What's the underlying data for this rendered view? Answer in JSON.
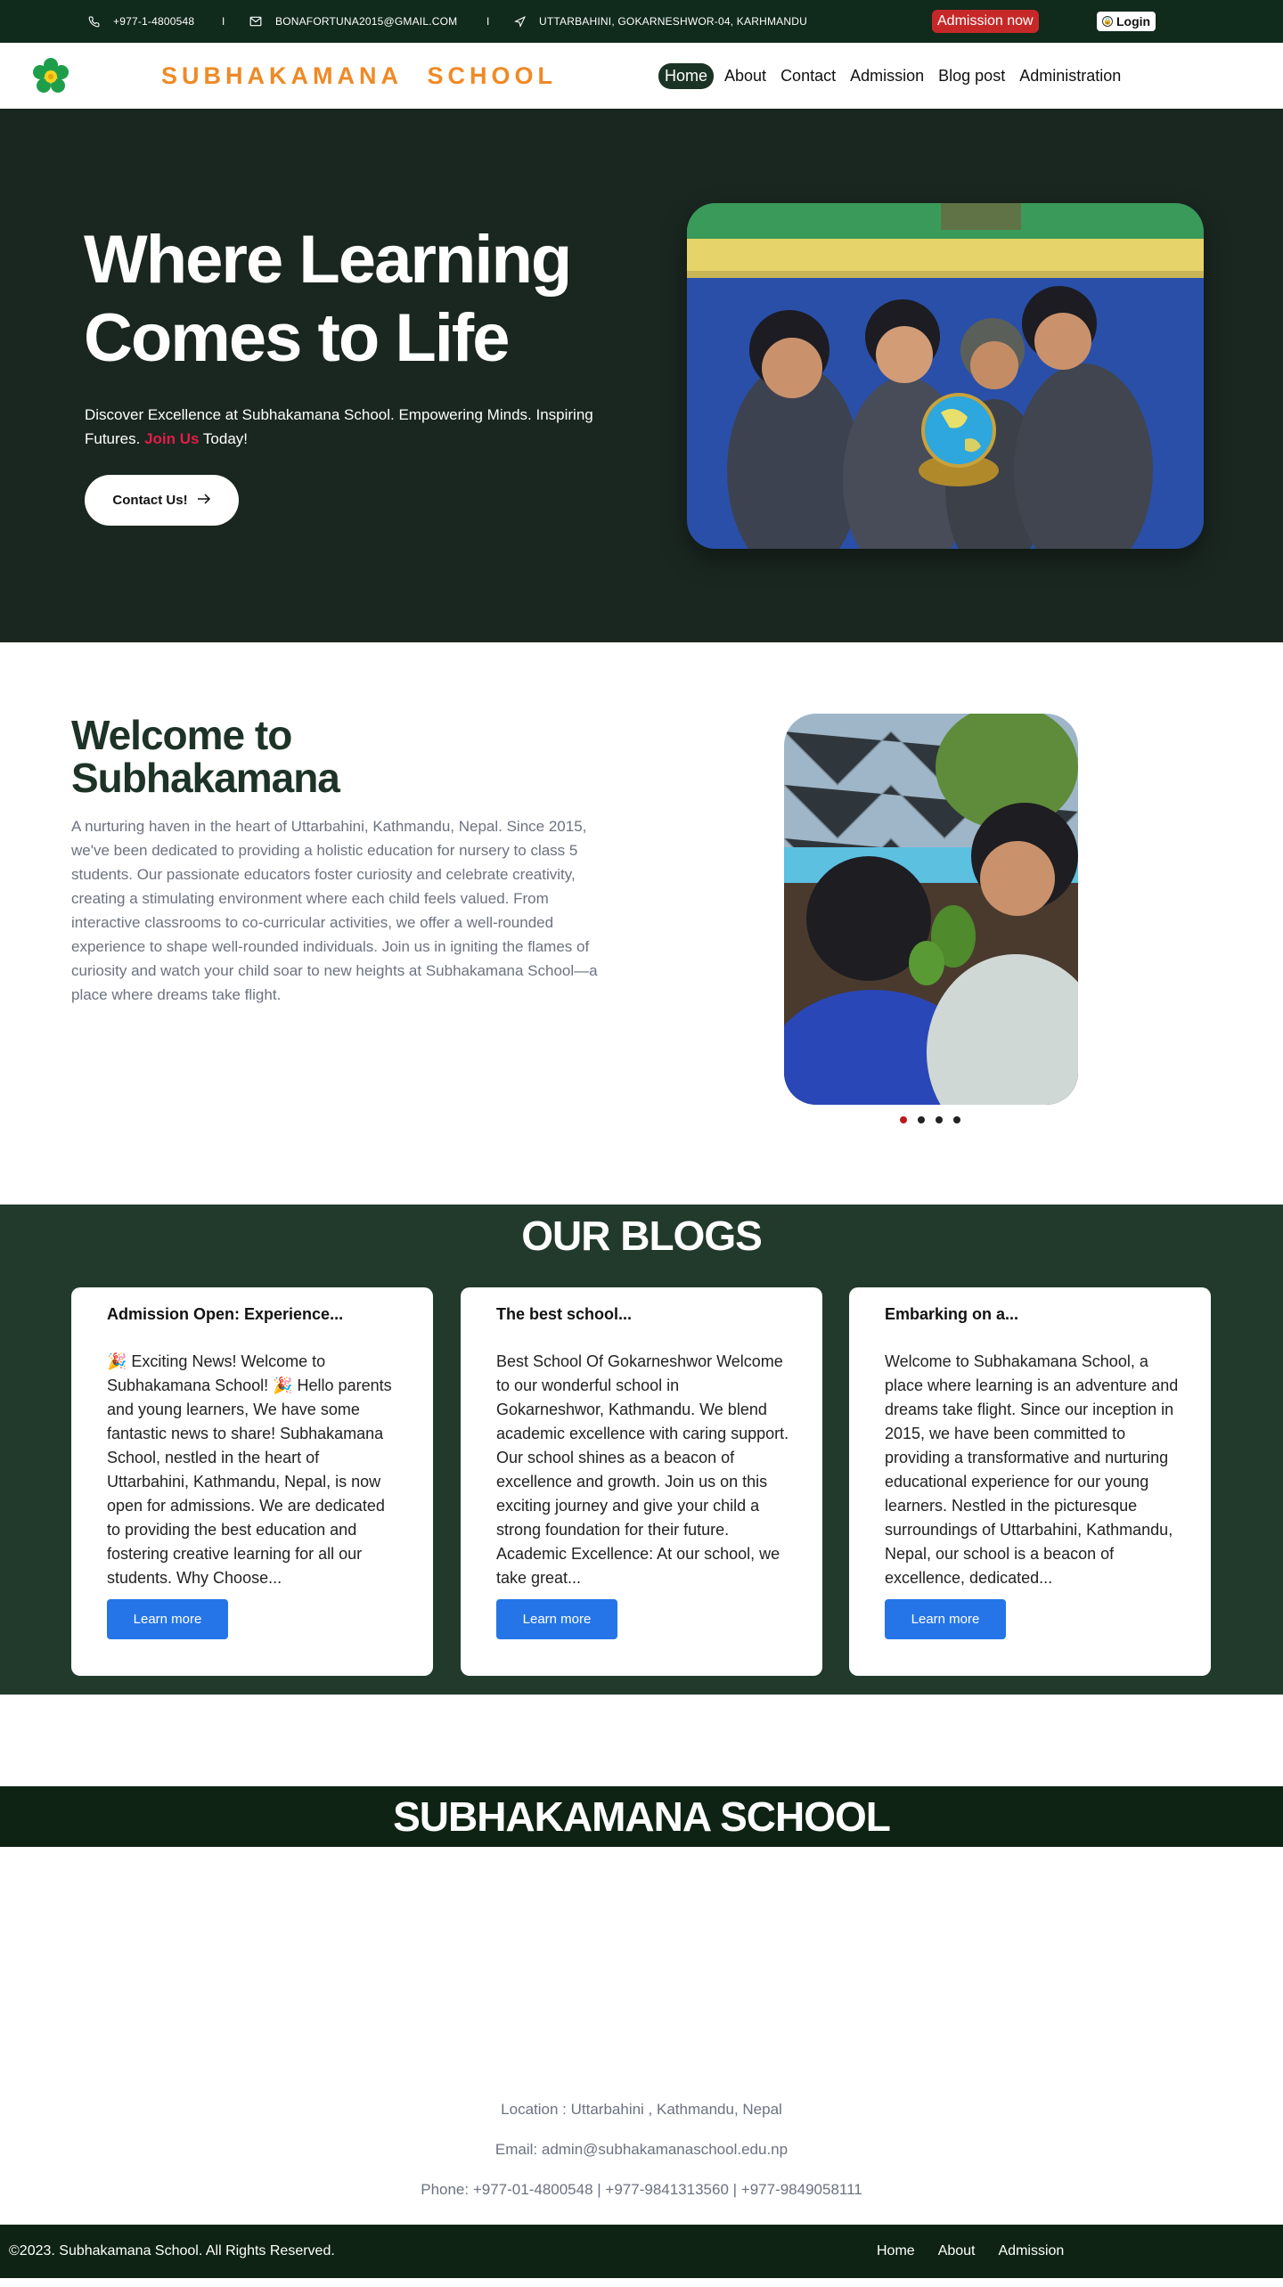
{
  "topbar": {
    "phone": "+977-1-4800548",
    "email": "BONAFORTUNA2015@GMAIL.COM",
    "address": "UTTARBAHINI, GOKARNESHWOR-04, KARHMANDU",
    "separator": "I",
    "admission_label": "Admission now",
    "login_label": "Login"
  },
  "nav": {
    "brand": "SUBHAKAMANA SCHOOL",
    "items": [
      {
        "label": "Home"
      },
      {
        "label": "About"
      },
      {
        "label": "Contact"
      },
      {
        "label": "Admission"
      },
      {
        "label": "Blog post"
      },
      {
        "label": "Administration"
      }
    ]
  },
  "hero": {
    "title": "Where Learning Comes to Life",
    "sub_before": "Discover Excellence at Subhakamana School. Empowering Minds. Inspiring Futures. ",
    "sub_link": "Join Us",
    "sub_after": " Today!",
    "cta": "Contact Us!"
  },
  "welcome": {
    "title": "Welcome to Subhakamana",
    "text": "A nurturing haven in the heart of Uttarbahini, Kathmandu, Nepal. Since 2015, we've been dedicated to providing a holistic education for nursery to class 5 students. Our passionate educators foster curiosity and celebrate creativity, creating a stimulating environment where each child feels valued. From interactive classrooms to co-curricular activities, we offer a well-rounded experience to shape well-rounded individuals. Join us in igniting the flames of curiosity and watch your child soar to new heights at Subhakamana School—a place where dreams take flight."
  },
  "blogs": {
    "title": "OUR BLOGS",
    "cards": [
      {
        "title": "Admission Open: Experience...",
        "excerpt": "🎉 Exciting News! Welcome to Subhakamana School! 🎉 Hello parents and young learners, We have some fantastic news to share! Subhakamana School, nestled in the heart of Uttarbahini, Kathmandu, Nepal, is now open for admissions. We are dedicated to providing the best education and fostering creative learning for all our students. Why Choose...",
        "button": "Learn more"
      },
      {
        "title": "The best school...",
        "excerpt": "Best School Of Gokarneshwor Welcome to our wonderful school in Gokarneshwor, Kathmandu. We blend academic excellence with caring support. Our school shines as a beacon of excellence and growth. Join us on this exciting journey and give your child a strong foundation for their future. Academic Excellence: At our school, we take great...",
        "button": "Learn more"
      },
      {
        "title": "Embarking on a...",
        "excerpt": "Welcome to Subhakamana School, a place where learning is an adventure and dreams take flight. Since our inception in 2015, we have been committed to providing a transformative and nurturing educational experience for our young learners. Nestled in the picturesque surroundings of Uttarbahini, Kathmandu, Nepal, our school is a beacon of excellence, dedicated...",
        "button": "Learn more"
      }
    ]
  },
  "footer": {
    "school_name": "SUBHAKAMANA SCHOOL",
    "location": "Location : Uttarbahini , Kathmandu, Nepal",
    "email": "Email: admin@subhakamanaschool.edu.np",
    "phone": "Phone: +977-01-4800548 | +977-9841313560 | +977-9849058111",
    "copyright": "©2023. Subhakamana School. All Rights Reserved.",
    "links": [
      {
        "label": "Home"
      },
      {
        "label": "About"
      },
      {
        "label": "Admission"
      }
    ]
  },
  "colors": {
    "topbar_bg": "#102a1c",
    "hero_bg": "#1a2720",
    "blogs_bg": "#223a2c",
    "brand_orange": "#ef8a26",
    "admission_red": "#c62828",
    "accent_pink": "#e11d48",
    "button_blue": "#2575e8"
  },
  "icons": [
    "phone-icon",
    "mail-icon",
    "location-arrow-icon",
    "lock-icon",
    "arrow-right-icon",
    "flower-logo"
  ]
}
